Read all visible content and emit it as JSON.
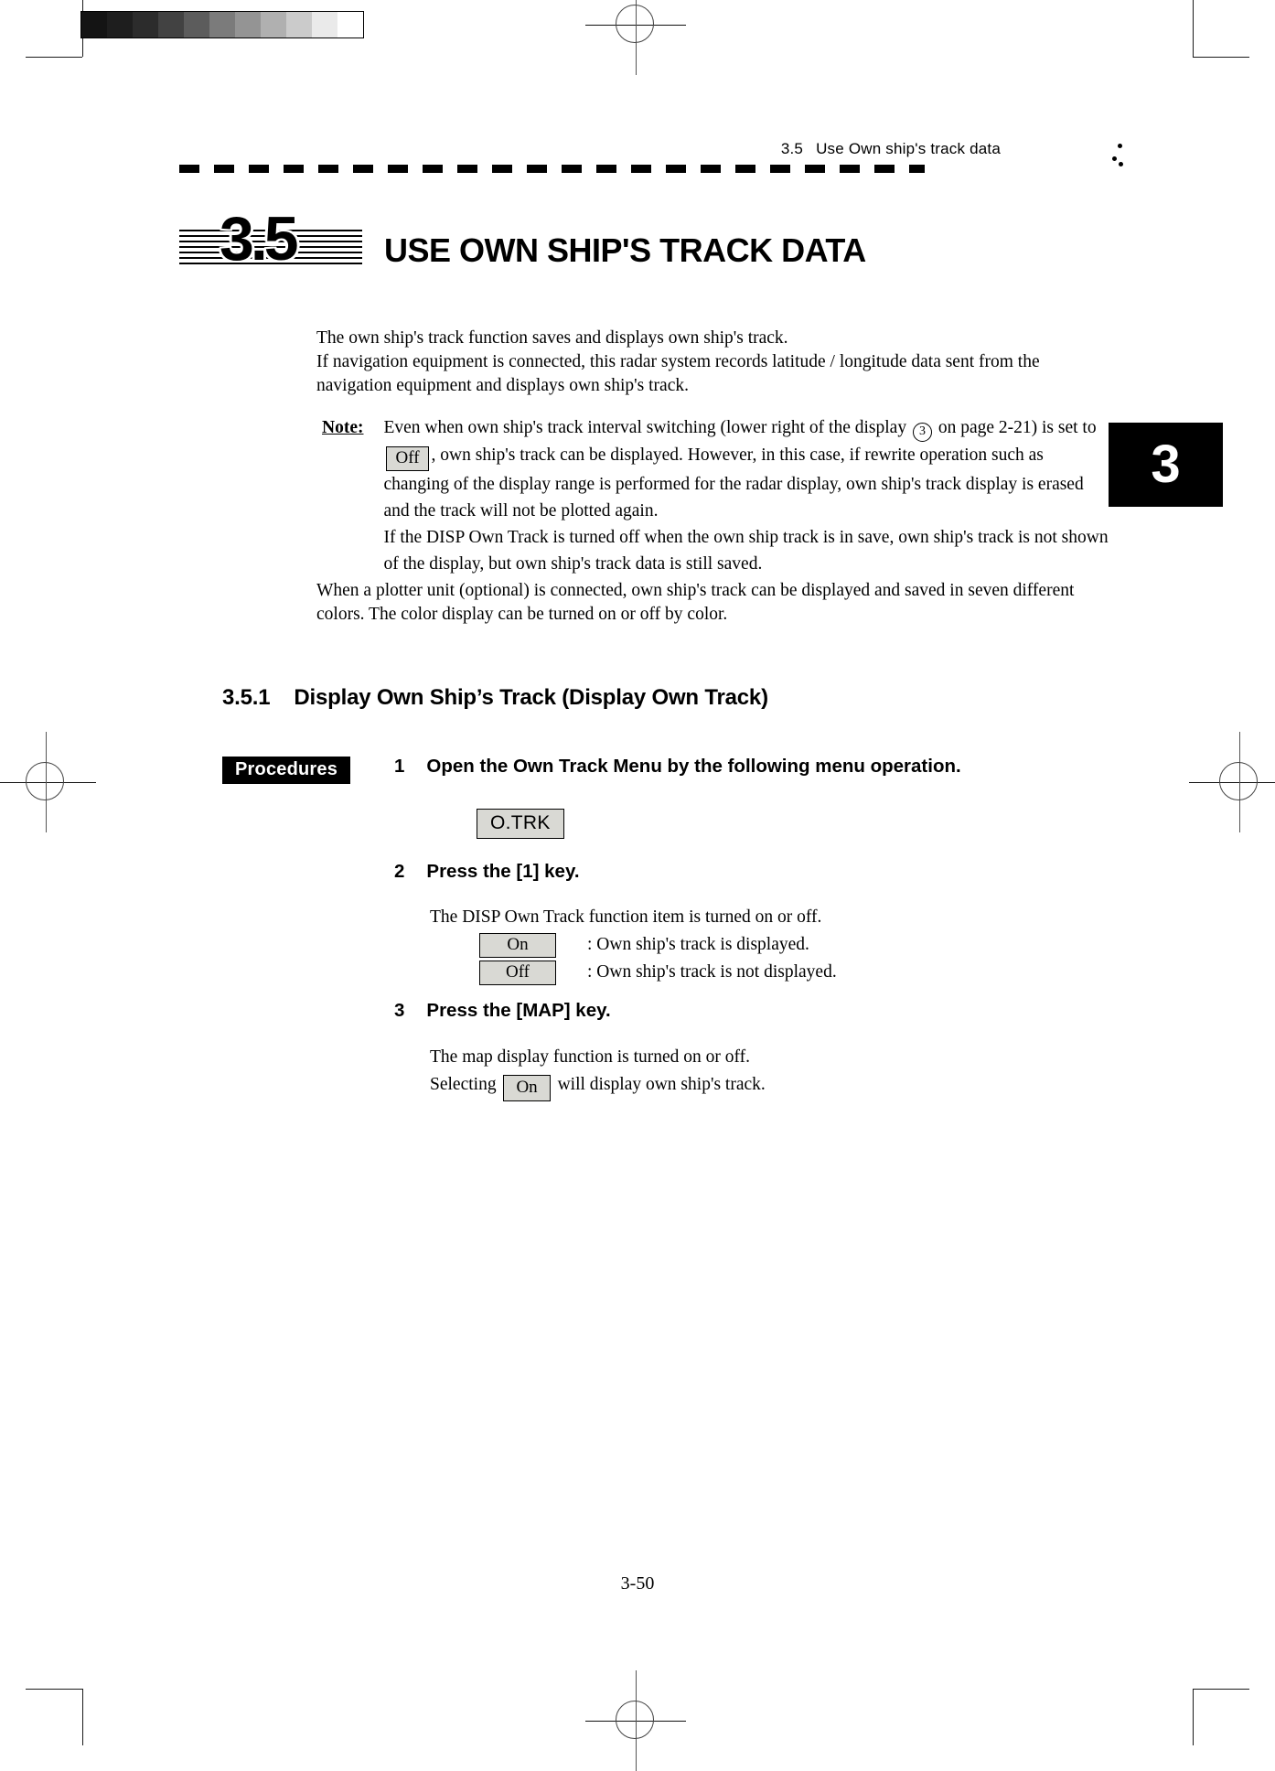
{
  "page": {
    "number": "3-50",
    "chapter_tab": "3"
  },
  "header": {
    "section_number": "3.5",
    "section_text": "Use Own ship's track data"
  },
  "chapter_heading": {
    "number": "3.5",
    "title": "USE OWN SHIP'S TRACK DATA"
  },
  "intro": {
    "line1": "The own ship's track function saves and displays own ship's track.",
    "line2": "If navigation equipment is connected, this radar system records latitude / longitude data sent from the navigation equipment and displays own ship's track."
  },
  "note": {
    "label": "Note:",
    "part1": "Even when own ship's track interval switching (lower right of the display",
    "circled_marker": "3",
    "part2": "on page 2-21) is set to",
    "key_off": "Off",
    "part3": ", own ship's track can be displayed.    However, in this case, if rewrite operation such as changing of the display range is performed for the radar display, own ship's track display is erased and the track will not be plotted again.",
    "part4": "If the DISP Own Track is turned off when the own ship track is in save, own ship's track is not shown of the display, but own ship's track data is still saved."
  },
  "closing": {
    "text": "When a plotter unit (optional) is connected, own ship's track can be displayed and saved in seven different colors.    The color display can be turned on or off by color."
  },
  "subsection": {
    "number": "3.5.1",
    "title": "Display Own Ship’s Track (Display Own Track)"
  },
  "procedures": {
    "tag": "Procedures",
    "steps": [
      {
        "number": "1",
        "title": "Open the Own Track Menu by the following menu operation.",
        "menu_key": "O.TRK"
      },
      {
        "number": "2",
        "title": "Press the [1] key.",
        "body_line": "The DISP Own Track function item is turned on or off.",
        "options": [
          {
            "key": "On",
            "desc": ": Own ship's track is displayed."
          },
          {
            "key": "Off",
            "desc": ": Own ship's track is not displayed."
          }
        ]
      },
      {
        "number": "3",
        "title": "Press the [MAP] key.",
        "body_line": "The map display function is turned on or off.",
        "select_prefix": "Selecting",
        "select_key": "On",
        "select_suffix": "will display own ship's track."
      }
    ]
  },
  "calibration_strip": {
    "swatches": [
      "#141414",
      "#1e1e1e",
      "#2c2c2c",
      "#424242",
      "#5c5c5c",
      "#7b7b7b",
      "#949494",
      "#b0b0b0",
      "#cbcbcb",
      "#eaeaea",
      "#ffffff"
    ]
  }
}
